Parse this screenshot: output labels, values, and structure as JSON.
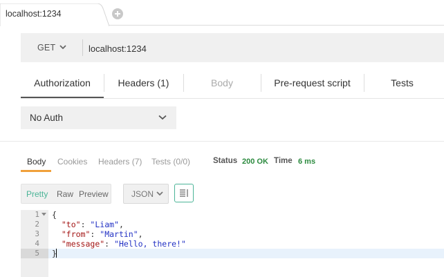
{
  "tabs": {
    "active_label": "localhost:1234"
  },
  "request": {
    "method": "GET",
    "url": "localhost:1234"
  },
  "request_tabs": [
    {
      "label": "Authorization",
      "state": "active"
    },
    {
      "label": "Headers (1)",
      "state": "normal"
    },
    {
      "label": "Body",
      "state": "disabled"
    },
    {
      "label": "Pre-request script",
      "state": "normal"
    },
    {
      "label": "Tests",
      "state": "normal"
    }
  ],
  "auth": {
    "type": "No Auth"
  },
  "response": {
    "tabs": [
      {
        "label": "Body",
        "state": "active"
      },
      {
        "label": "Cookies",
        "state": "normal"
      },
      {
        "label": "Headers (7)",
        "state": "normal"
      },
      {
        "label": "Tests (0/0)",
        "state": "normal"
      }
    ],
    "status_label": "Status",
    "status_value": "200 OK",
    "time_label": "Time",
    "time_value": "6 ms",
    "views": [
      "Pretty",
      "Raw",
      "Preview"
    ],
    "active_view": "Pretty",
    "format": "JSON"
  },
  "editor": {
    "line_numbers": [
      "1",
      "2",
      "3",
      "4",
      "5"
    ],
    "active_line": "5",
    "open_brace": "{",
    "close_brace": "}",
    "entries": [
      {
        "key": "\"to\"",
        "value": "\"Liam\"",
        "trail": ","
      },
      {
        "key": "\"from\"",
        "value": "\"Martin\"",
        "trail": ","
      },
      {
        "key": "\"message\"",
        "value": "\"Hello, there!\"",
        "trail": ""
      }
    ]
  },
  "colors": {
    "accent_orange": "#f0a03a",
    "accent_green": "#4bb497",
    "status_green": "#2b8a3e",
    "json_key": "#a31515",
    "json_string": "#2231c4"
  },
  "icons": [
    "add-tab-icon",
    "chevron-down-icon",
    "wrap-lines-icon",
    "fold-arrow-icon"
  ]
}
